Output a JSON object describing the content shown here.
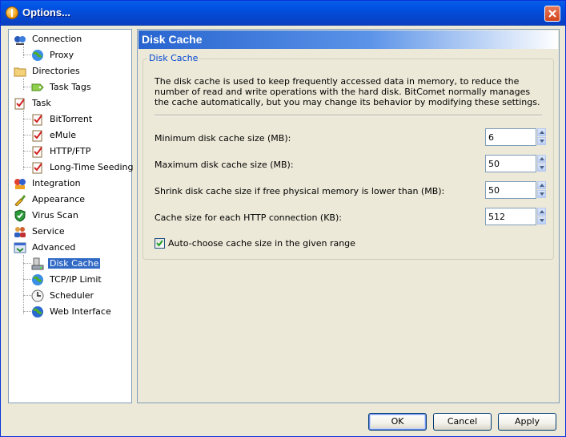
{
  "window": {
    "title": "Options..."
  },
  "tree": {
    "items": [
      {
        "label": "Connection",
        "icon": "network-icon"
      },
      {
        "label": "Proxy",
        "icon": "globe-icon"
      },
      {
        "label": "Directories",
        "icon": "folder-icon"
      },
      {
        "label": "Task Tags",
        "icon": "tag-icon"
      },
      {
        "label": "Task",
        "icon": "clipboard-icon"
      },
      {
        "label": "BitTorrent",
        "icon": "clipboard-icon"
      },
      {
        "label": "eMule",
        "icon": "clipboard-icon"
      },
      {
        "label": "HTTP/FTP",
        "icon": "clipboard-icon"
      },
      {
        "label": "Long-Time Seeding",
        "icon": "clipboard-icon"
      },
      {
        "label": "Integration",
        "icon": "puzzle-icon"
      },
      {
        "label": "Appearance",
        "icon": "paint-icon"
      },
      {
        "label": "Virus Scan",
        "icon": "shield-icon"
      },
      {
        "label": "Service",
        "icon": "people-icon"
      },
      {
        "label": "Advanced",
        "icon": "settings-icon"
      },
      {
        "label": "Disk Cache",
        "icon": "disk-icon"
      },
      {
        "label": "TCP/IP Limit",
        "icon": "globe-icon"
      },
      {
        "label": "Scheduler",
        "icon": "clock-icon"
      },
      {
        "label": "Web Interface",
        "icon": "globe-icon"
      }
    ],
    "selected": "Disk Cache"
  },
  "panel": {
    "header": "Disk Cache",
    "group_title": "Disk Cache",
    "description": "The disk cache is used to keep frequently accessed data in memory, to reduce the number of read and write operations with the hard disk. BitComet normally manages the cache automatically, but you may change its behavior by modifying these settings.",
    "fields": [
      {
        "label": "Minimum disk cache size (MB):",
        "value": "6"
      },
      {
        "label": "Maximum disk cache size (MB):",
        "value": "50"
      },
      {
        "label": "Shrink disk cache size if free physical memory is lower than (MB):",
        "value": "50"
      },
      {
        "label": "Cache size for each HTTP connection (KB):",
        "value": "512"
      }
    ],
    "auto_choose": {
      "label": "Auto-choose cache size in the given range",
      "checked": true
    }
  },
  "buttons": {
    "ok": "OK",
    "cancel": "Cancel",
    "apply": "Apply"
  },
  "colors": {
    "selection": "#316ac5",
    "titlebar": "#0055e5",
    "group_title": "#0046d5"
  }
}
